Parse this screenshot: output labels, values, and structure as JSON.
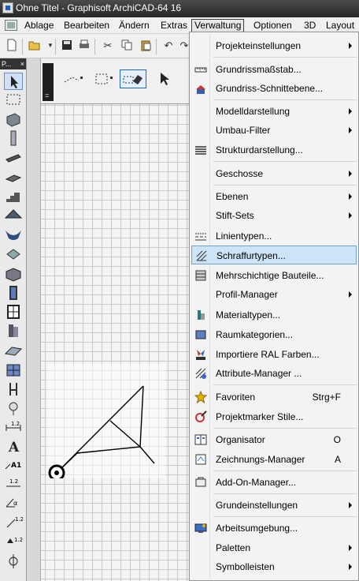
{
  "window": {
    "title": "Ohne Titel - Graphisoft ArchiCAD-64 16"
  },
  "menubar": {
    "items": [
      {
        "label": "Ablage"
      },
      {
        "label": "Bearbeiten"
      },
      {
        "label": "Ändern"
      },
      {
        "label": "Extras"
      },
      {
        "label": "Verwaltung",
        "active": true
      },
      {
        "label": "Optionen"
      },
      {
        "label": "3D"
      },
      {
        "label": "Layout"
      }
    ]
  },
  "palette": {
    "title": "P..."
  },
  "verwaltung_menu": {
    "highlighted": "Schraffurtypen...",
    "items": [
      {
        "label": "Projekteinstellungen",
        "submenu": true
      },
      {
        "label": "Grundrissmaßstab...",
        "icon": "scale-ruler-icon"
      },
      {
        "label": "Grundriss-Schnittebene...",
        "icon": "cut-plane-icon"
      },
      {
        "label": "Modelldarstellung",
        "submenu": true
      },
      {
        "label": "Umbau-Filter",
        "submenu": true
      },
      {
        "label": "Strukturdarstellung...",
        "icon": "structure-icon"
      },
      {
        "label": "Geschosse",
        "submenu": true
      },
      {
        "label": "Ebenen",
        "submenu": true
      },
      {
        "label": "Stift-Sets",
        "submenu": true
      },
      {
        "label": "Linientypen...",
        "icon": "line-types-icon"
      },
      {
        "label": "Schraffurtypen...",
        "icon": "fill-types-icon"
      },
      {
        "label": "Mehrschichtige Bauteile...",
        "icon": "composites-icon"
      },
      {
        "label": "Profil-Manager",
        "submenu": true
      },
      {
        "label": "Materialtypen...",
        "icon": "materials-icon"
      },
      {
        "label": "Raumkategorien...",
        "icon": "zone-categories-icon"
      },
      {
        "label": "Importiere RAL Farben...",
        "icon": "ral-colors-icon"
      },
      {
        "label": "Attribute-Manager ...",
        "icon": "attribute-manager-icon"
      },
      {
        "label": "Favoriten",
        "shortcut": "Strg+F",
        "icon": "star-icon"
      },
      {
        "label": "Projektmarker Stile...",
        "icon": "project-marker-icon"
      },
      {
        "label": "Organisator",
        "shortcut": "O",
        "icon": "organizer-icon"
      },
      {
        "label": "Zeichnungs-Manager",
        "shortcut": "A",
        "icon": "drawing-manager-icon"
      },
      {
        "label": "Add-On-Manager...",
        "icon": "addon-manager-icon"
      },
      {
        "label": "Grundeinstellungen",
        "submenu": true
      },
      {
        "label": "Arbeitsumgebung...",
        "icon": "work-environment-icon"
      },
      {
        "label": "Paletten",
        "submenu": true
      },
      {
        "label": "Symbolleisten",
        "submenu": true
      }
    ]
  },
  "colors": {
    "menu_highlight": "#cde4f7",
    "menu_highlight_border": "#6fa3d6",
    "title_bar": "#262626",
    "selection_blue": "#1e65c9"
  }
}
